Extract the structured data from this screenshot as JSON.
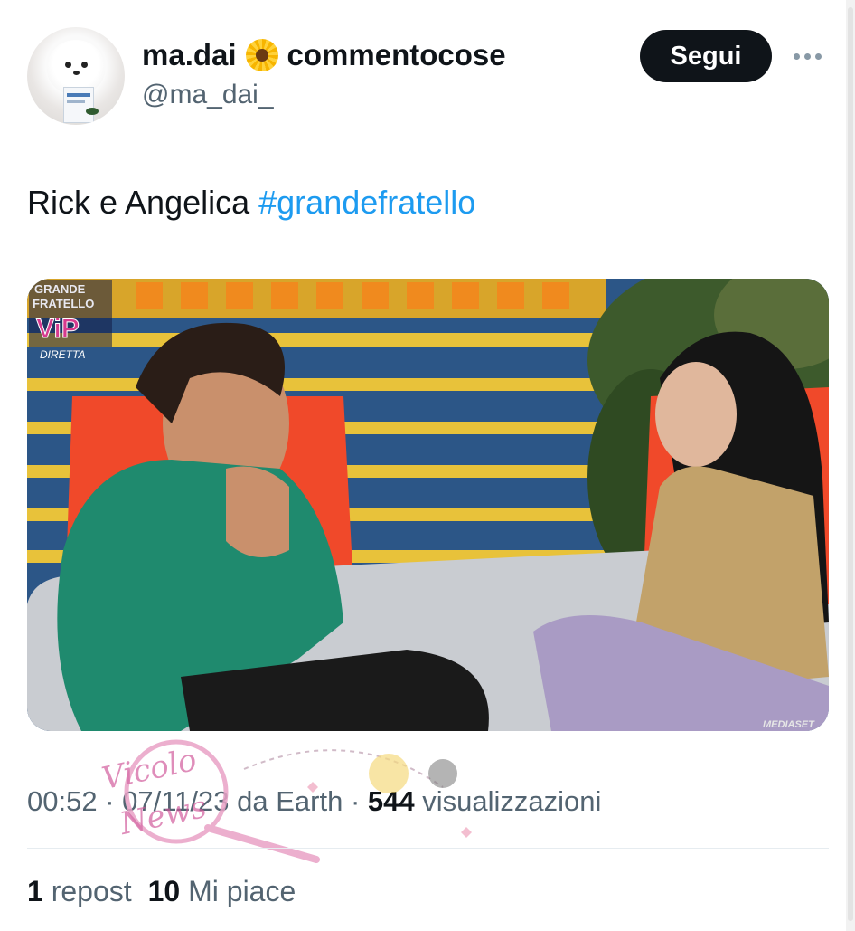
{
  "author": {
    "display_name_part1": "ma.dai",
    "emoji_icon": "sunflower-icon",
    "display_name_part2": "commentocose",
    "handle": "@ma_dai_"
  },
  "follow_button": {
    "label": "Segui"
  },
  "more_icon": "more-dots-icon",
  "tweet": {
    "text": "Rick e Angelica ",
    "hashtag": "#grandefratello"
  },
  "media": {
    "logo_line1": "GRANDE",
    "logo_line2": "FRATELLO",
    "logo_vip": "ViP",
    "logo_live": "DIRETTA",
    "corner_mark": "MEDIASET"
  },
  "meta": {
    "time": "00:52",
    "separator1": " · ",
    "date": "07/11/23",
    "source": " da Earth",
    "separator2": " · ",
    "views_count": "544",
    "views_label": " visualizzazioni"
  },
  "watermark": {
    "text_line1": "Vicolo",
    "text_line2": "News"
  },
  "stats": {
    "reposts_count": "1",
    "reposts_label": " repost",
    "likes_count": "10",
    "likes_label": " Mi piace"
  },
  "colors": {
    "accent": "#1d9bf0",
    "text": "#0f1419",
    "muted": "#536471",
    "button_bg": "#0f1419"
  }
}
